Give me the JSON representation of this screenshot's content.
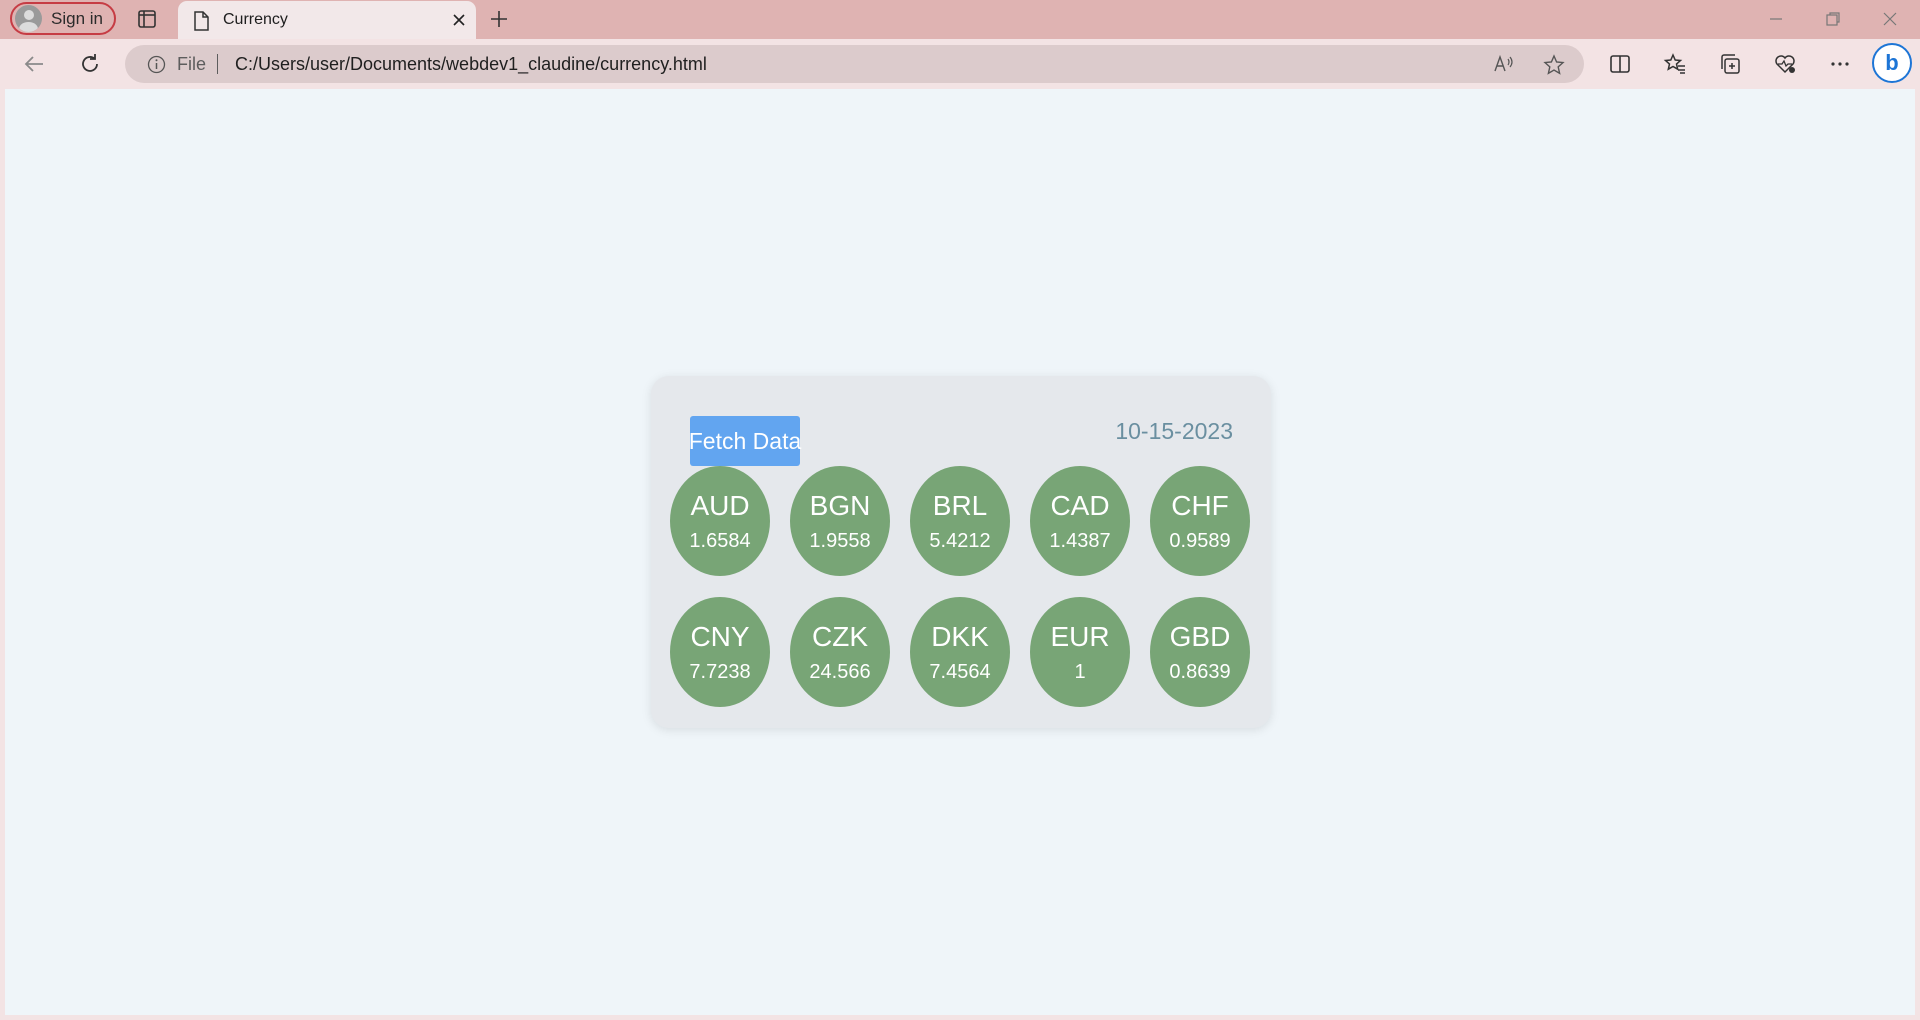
{
  "browser": {
    "signin_label": "Sign in",
    "tab_title": "Currency",
    "address_scheme": "File",
    "address_url": "C:/Users/user/Documents/webdev1_claudine/currency.html",
    "bing_label": "b"
  },
  "app": {
    "fetch_button_label": "Fetch Data",
    "date": "10-15-2023",
    "colors": {
      "page_background": "#eff5f9",
      "card_background": "#e5e8ec",
      "coin_background": "#78a576",
      "button_background": "#62a5f0",
      "date_text": "#6a8fa0"
    },
    "currencies": [
      {
        "code": "AUD",
        "rate": "1.6584"
      },
      {
        "code": "BGN",
        "rate": "1.9558"
      },
      {
        "code": "BRL",
        "rate": "5.4212"
      },
      {
        "code": "CAD",
        "rate": "1.4387"
      },
      {
        "code": "CHF",
        "rate": "0.9589"
      },
      {
        "code": "CNY",
        "rate": "7.7238"
      },
      {
        "code": "CZK",
        "rate": "24.566"
      },
      {
        "code": "DKK",
        "rate": "7.4564"
      },
      {
        "code": "EUR",
        "rate": "1"
      },
      {
        "code": "GBD",
        "rate": "0.8639"
      }
    ]
  }
}
